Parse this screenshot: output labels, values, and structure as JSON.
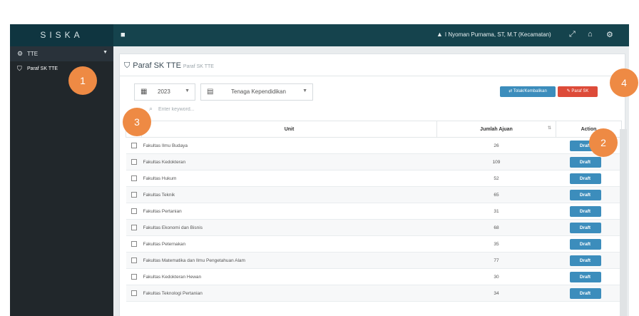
{
  "topbar": {
    "brand": "SISKA",
    "home_icon": "home-icon",
    "user_text": "I Nyoman Purnama, ST, M.T (Kecamatan)",
    "icons": [
      "expand-icon",
      "bank-icon",
      "gear-icon"
    ]
  },
  "sidebar": {
    "header_label": "TTE",
    "items": [
      {
        "label": "Paraf SK TTE",
        "icon": "shield-icon"
      }
    ]
  },
  "panel": {
    "title": "Paraf SK TTE",
    "subtitle": "Paraf SK TTE",
    "filters": {
      "year_value": "2023",
      "type_value": "Tenaga Kependidikan"
    },
    "buttons": {
      "secondary_label": "Tolak/Kembalikan",
      "primary_label": "Paraf SK"
    },
    "search_placeholder": "Enter keyword..."
  },
  "table": {
    "headers": {
      "unit": "Unit",
      "count": "Jumlah Ajuan",
      "action": "Action"
    },
    "rows": [
      {
        "unit": "Fakultas Ilmu Budaya",
        "count": "26",
        "action": "Draft"
      },
      {
        "unit": "Fakultas Kedokteran",
        "count": "109",
        "action": "Draft"
      },
      {
        "unit": "Fakultas Hukum",
        "count": "52",
        "action": "Draft"
      },
      {
        "unit": "Fakultas Teknik",
        "count": "65",
        "action": "Draft"
      },
      {
        "unit": "Fakultas Pertanian",
        "count": "31",
        "action": "Draft"
      },
      {
        "unit": "Fakultas Ekonomi dan Bisnis",
        "count": "68",
        "action": "Draft"
      },
      {
        "unit": "Fakultas Peternakan",
        "count": "35",
        "action": "Draft"
      },
      {
        "unit": "Fakultas Matematika dan Ilmu Pengetahuan Alam",
        "count": "77",
        "action": "Draft"
      },
      {
        "unit": "Fakultas Kedokteran Hewan",
        "count": "30",
        "action": "Draft"
      },
      {
        "unit": "Fakultas Teknologi Pertanian",
        "count": "34",
        "action": "Draft"
      }
    ]
  },
  "callouts": [
    "1",
    "2",
    "3",
    "4"
  ],
  "colors": {
    "topbar": "#15434d",
    "sidebar": "#21272b",
    "draft_button": "#3c8dbc",
    "secondary_button": "#3c8dbc",
    "primary_button": "#dd4b39",
    "callout": "#ee8a44"
  }
}
